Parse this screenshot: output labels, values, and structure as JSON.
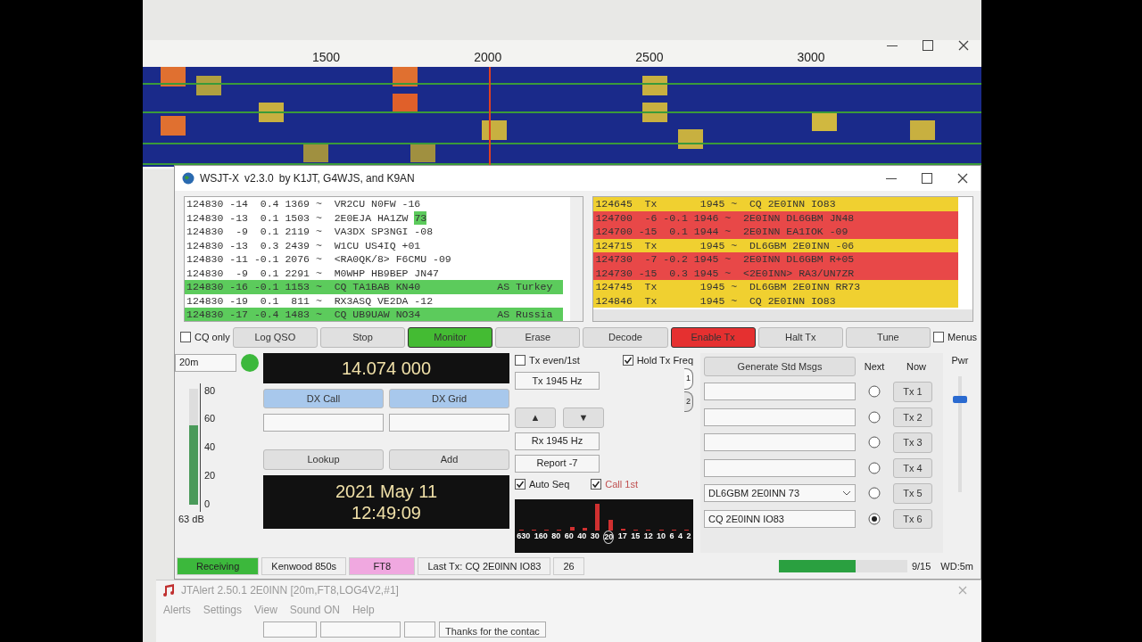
{
  "waterfall": {
    "scale": [
      "1500",
      "2000",
      "2500",
      "3000"
    ]
  },
  "window": {
    "title": "WSJT-X",
    "version": "v2.3.0",
    "authors": "by K1JT, G4WJS, and K9AN"
  },
  "band_activity": [
    {
      "line": "124830 -14  0.4 1369 ~  VR2CU N0FW -16",
      "cq": false
    },
    {
      "line": "124830 -13  0.1 1503 ~  2E0EJA HA1ZW",
      "marked": "73",
      "cq": false
    },
    {
      "line": "124830  -9  0.1 2119 ~  VA3DX SP3NGI -08",
      "cq": false
    },
    {
      "line": "124830 -13  0.3 2439 ~  W1CU US4IQ +01",
      "cq": false
    },
    {
      "line": "124830 -11 -0.1 2076 ~  <RA0QK/8> F6CMU -09",
      "cq": false
    },
    {
      "line": "124830  -9  0.1 2291 ~  M0WHP HB9BEP JN47",
      "cq": false
    },
    {
      "line": "124830 -16 -0.1 1153 ~  CQ TA1BAB KN40",
      "country": "AS Turkey",
      "cq": true
    },
    {
      "line": "124830 -19  0.1  811 ~  RX3ASQ VE2DA -12",
      "cq": false
    },
    {
      "line": "124830 -17 -0.4 1483 ~  CQ UB9UAW NO34",
      "country": "AS Russia",
      "cq": true
    }
  ],
  "rx_frequency": [
    {
      "line": "124645  Tx       1945 ~  CQ 2E0INN IO83",
      "kind": "tx"
    },
    {
      "line": "124700  -6 -0.1 1946 ~  2E0INN DL6GBM JN48",
      "kind": "rx"
    },
    {
      "line": "124700 -15  0.1 1944 ~  2E0INN EA1IOK -09",
      "kind": "rx"
    },
    {
      "line": "124715  Tx       1945 ~  DL6GBM 2E0INN -06",
      "kind": "tx"
    },
    {
      "line": "124730  -7 -0.2 1945 ~  2E0INN DL6GBM R+05",
      "kind": "rx"
    },
    {
      "line": "124730 -15  0.3 1945 ~  <2E0INN> RA3/UN7ZR",
      "kind": "rx"
    },
    {
      "line": "124745  Tx       1945 ~  DL6GBM 2E0INN RR73",
      "kind": "tx"
    },
    {
      "line": "124846  Tx       1945 ~  CQ 2E0INN IO83",
      "kind": "tx"
    }
  ],
  "toolbar": [
    {
      "kind": "check",
      "label": "CQ only",
      "checked": false
    },
    {
      "kind": "button",
      "label": "Log QSO",
      "on": false
    },
    {
      "kind": "button",
      "label": "Stop",
      "on": false
    },
    {
      "kind": "button",
      "label": "Monitor",
      "on": true,
      "color": "#44bb33"
    },
    {
      "kind": "button",
      "label": "Erase",
      "on": false
    },
    {
      "kind": "button",
      "label": "Decode",
      "on": false
    },
    {
      "kind": "button",
      "label": "Enable Tx",
      "on": true,
      "color": "#e53030"
    },
    {
      "kind": "button",
      "label": "Halt Tx",
      "on": false
    },
    {
      "kind": "button",
      "label": "Tune",
      "on": false
    },
    {
      "kind": "check",
      "label": "Menus",
      "checked": false
    }
  ],
  "band": "20m",
  "meter": {
    "ticks": [
      "80",
      "60",
      "40",
      "20",
      "0"
    ],
    "level": 0.68,
    "reading": "63 dB"
  },
  "frequency": "14.074 000",
  "dx_call": "DX Call",
  "dx_grid": "DX Grid",
  "lookup": "Lookup",
  "add": "Add",
  "date": "2021 May 11",
  "time": "12:49:09",
  "options": [
    {
      "label": "Tx even/1st",
      "checked": false
    },
    {
      "label": "Hold Tx Freq",
      "checked": true
    }
  ],
  "tx_spin": "Tx  1945 Hz",
  "arrows": [
    "▲",
    "▼"
  ],
  "rx_spin": "Rx  1945 Hz",
  "report_spin": "Report -7",
  "seq_options": [
    {
      "label": "Auto Seq",
      "checked": true
    },
    {
      "label": "Call 1st",
      "checked": true
    }
  ],
  "tabs": [
    {
      "label": "1",
      "selected": true
    },
    {
      "label": "2",
      "selected": false
    }
  ],
  "band_chart": [
    {
      "label": "630",
      "selected": false
    },
    {
      "label": "160",
      "selected": false
    },
    {
      "label": "80",
      "selected": false
    },
    {
      "label": "60",
      "selected": false
    },
    {
      "label": "40",
      "selected": false
    },
    {
      "label": "30",
      "selected": false
    },
    {
      "label": "20",
      "selected": true
    },
    {
      "label": "17",
      "selected": false
    },
    {
      "label": "15",
      "selected": false
    },
    {
      "label": "12",
      "selected": false
    },
    {
      "label": "10",
      "selected": false
    },
    {
      "label": "6",
      "selected": false
    },
    {
      "label": "4",
      "selected": false
    },
    {
      "label": "2",
      "selected": false
    }
  ],
  "tx_panel": {
    "generate": "Generate Std Msgs",
    "next": "Next",
    "now": "Now",
    "pwr": "Pwr",
    "power": {
      "level": 0.8
    },
    "messages": [
      {
        "button": "Tx 1",
        "selected": false
      },
      {
        "button": "Tx 2",
        "selected": false
      },
      {
        "button": "Tx 3",
        "selected": false
      },
      {
        "button": "Tx 4",
        "selected": false
      },
      {
        "text": "DL6GBM 2E0INN 73",
        "dropdown": true,
        "button": "Tx 5",
        "selected": false
      },
      {
        "text": "CQ 2E0INN IO83",
        "dropdown": false,
        "button": "Tx 6",
        "selected": true
      }
    ]
  },
  "status_bar": {
    "state": "Receiving",
    "rig": "Kenwood 850s",
    "mode": "FT8",
    "last_tx": "Last Tx: CQ 2E0INN IO83",
    "count": "26",
    "progress": {
      "level": 0.6
    },
    "period": "9/15",
    "watchdog": "WD:5m"
  },
  "jtalert": {
    "title": "JTAlert 2.50.1 2E0INN [20m,FT8,LOG4V2,#1]",
    "menu": [
      "Alerts",
      "Settings",
      "View",
      "Sound ON",
      "Help"
    ],
    "message": "Thanks for the contac"
  }
}
